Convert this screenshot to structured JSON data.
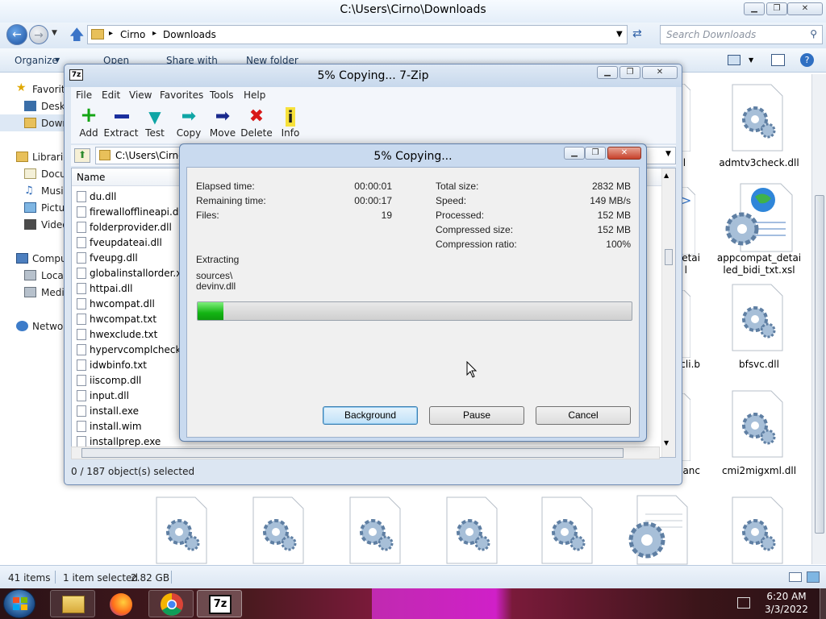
{
  "explorer": {
    "title": "C:\\Users\\Cirno\\Downloads",
    "breadcrumb": [
      "Cirno",
      "Downloads"
    ],
    "search_placeholder": "Search Downloads",
    "commands": [
      "Organize",
      "Open",
      "Share with",
      "New folder"
    ],
    "sidebar": [
      "Favorit",
      "Deskt",
      "Down",
      "Librarie",
      "Docu",
      "Musi",
      "Pictu",
      "Video",
      "Compu",
      "Local",
      "Medi",
      "Netwo"
    ],
    "status_items": "41 items",
    "status_selected": "1 item selected",
    "status_size": "2.82 GB",
    "right_files": [
      {
        "label": "dll"
      },
      {
        "label": "admtv3check.dll"
      },
      {
        "label": "etai"
      },
      {
        "label": "l"
      },
      {
        "label": "appcompat_detai"
      },
      {
        "label": "led_bidi_txt.xsl"
      },
      {
        "label": "cli.b"
      },
      {
        "label": "bfsvc.dll"
      },
      {
        "label": "ianc"
      },
      {
        "label": "cmi2migxml.dll"
      }
    ]
  },
  "zip": {
    "title": "5% Copying... 7-Zip",
    "menu": [
      "File",
      "Edit",
      "View",
      "Favorites",
      "Tools",
      "Help"
    ],
    "toolbar": [
      "Add",
      "Extract",
      "Test",
      "Copy",
      "Move",
      "Delete",
      "Info"
    ],
    "path": "C:\\Users\\Cirno",
    "column_name": "Name",
    "files": [
      "du.dll",
      "firewallofflineapi.dll",
      "folderprovider.dll",
      "fveupdateai.dll",
      "fveupg.dll",
      "globalinstallorder.xm",
      "httpai.dll",
      "hwcompat.dll",
      "hwcompat.txt",
      "hwexclude.txt",
      "hypervcomplcheck.dl",
      "idwbinfo.txt",
      "iiscomp.dll",
      "input.dll",
      "install.exe",
      "install.wim",
      "installprep.exe"
    ],
    "status": "0 / 187 object(s) selected"
  },
  "copy": {
    "title": "5% Copying...",
    "elapsed_label": "Elapsed time:",
    "elapsed": "00:00:01",
    "remaining_label": "Remaining time:",
    "remaining": "00:00:17",
    "files_label": "Files:",
    "files": "19",
    "total_label": "Total size:",
    "total": "2832 MB",
    "speed_label": "Speed:",
    "speed": "149 MB/s",
    "processed_label": "Processed:",
    "processed": "152 MB",
    "compressed_label": "Compressed size:",
    "compressed": "152 MB",
    "ratio_label": "Compression ratio:",
    "ratio": "100%",
    "action": "Extracting",
    "path1": "sources\\",
    "path2": "devinv.dll",
    "progress": 0.06,
    "btn_background": "Background",
    "btn_pause": "Pause",
    "btn_cancel": "Cancel"
  },
  "taskbar": {
    "time": "6:20 AM",
    "date": "3/3/2022"
  }
}
